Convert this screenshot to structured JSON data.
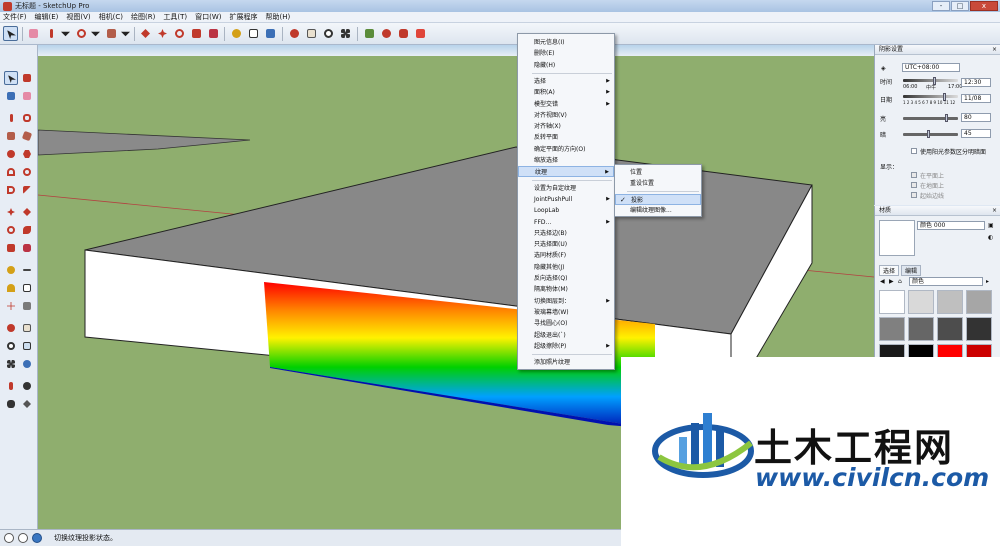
{
  "window": {
    "title": "无标题 - SketchUp Pro",
    "min": "-",
    "max": "□",
    "close": "x"
  },
  "menubar": [
    "文件(F)",
    "编辑(E)",
    "视图(V)",
    "相机(C)",
    "绘图(R)",
    "工具(T)",
    "窗口(W)",
    "扩展程序",
    "帮助(H)"
  ],
  "context_menu": [
    {
      "label": "图元信息(I)"
    },
    {
      "label": "删除(E)"
    },
    {
      "label": "隐藏(H)"
    },
    {
      "sep": true
    },
    {
      "label": "选择",
      "sub": true
    },
    {
      "label": "面积(A)",
      "sub": true
    },
    {
      "label": "模型交错",
      "sub": true
    },
    {
      "label": "对齐视图(V)"
    },
    {
      "label": "对齐轴(X)"
    },
    {
      "label": "反转平面"
    },
    {
      "label": "确定平面的方向(O)"
    },
    {
      "label": "缩放选择"
    },
    {
      "label": "纹理",
      "sub": true,
      "hl": true
    },
    {
      "sep": true
    },
    {
      "label": "设置为自定纹理"
    },
    {
      "label": "JointPushPull",
      "sub": true
    },
    {
      "label": "LoopLab"
    },
    {
      "label": "FFD...",
      "sub": true
    },
    {
      "label": "只选择边(B)"
    },
    {
      "label": "只选择面(U)"
    },
    {
      "label": "选同材质(F)"
    },
    {
      "label": "隐藏其他(J)"
    },
    {
      "label": "反向选择(Q)"
    },
    {
      "label": "隔离物体(M)"
    },
    {
      "label": "切换图层到：",
      "sub": true
    },
    {
      "label": "玻璃幕墙(W)"
    },
    {
      "label": "寻找圆心(O)"
    },
    {
      "label": "超级退出(`)"
    },
    {
      "label": "超级擦除(P)",
      "sub": true
    },
    {
      "sep": true
    },
    {
      "label": "添加照片纹理"
    }
  ],
  "submenu": [
    {
      "label": "位置"
    },
    {
      "label": "重设位置"
    },
    {
      "sep": true
    },
    {
      "label": "投影",
      "checked": true,
      "check": "✓",
      "hl": true
    },
    {
      "label": "编辑纹理图像..."
    }
  ],
  "shadow_panel": {
    "title": "阴影设置",
    "timezone": "UTC+08:00",
    "time_label": "时间",
    "time_start": "06:00",
    "time_noon": "中午",
    "time_end": "17:00",
    "time_value": "12:30",
    "date_label": "日期",
    "months": "1 2 3 4 5 6 7 8 9 10 11 12",
    "date_value": "11/08",
    "light_label": "亮",
    "light_value": "80",
    "dark_label": "暗",
    "dark_value": "45",
    "use_sun": "使用阳光参数区分明暗面",
    "display_label": "显示：",
    "on_faces": "在平面上",
    "on_ground": "在地面上",
    "from_edges": "起始边线"
  },
  "materials_panel": {
    "title": "材质",
    "color_name": "颜色 000",
    "tab_select": "选择",
    "tab_edit": "编辑",
    "library": "颜色",
    "swatches": [
      "#ffffff",
      "#d9d9d9",
      "#bfbfbf",
      "#a6a6a6",
      "#808080",
      "#666666",
      "#4d4d4d",
      "#333333",
      "#1a1a1a",
      "#000000",
      "#ff0000",
      "#cc0000"
    ]
  },
  "status": {
    "message": "切换纹理投影状态。"
  },
  "watermark": {
    "name": "土木工程网",
    "url": "www.civilcn.com"
  }
}
